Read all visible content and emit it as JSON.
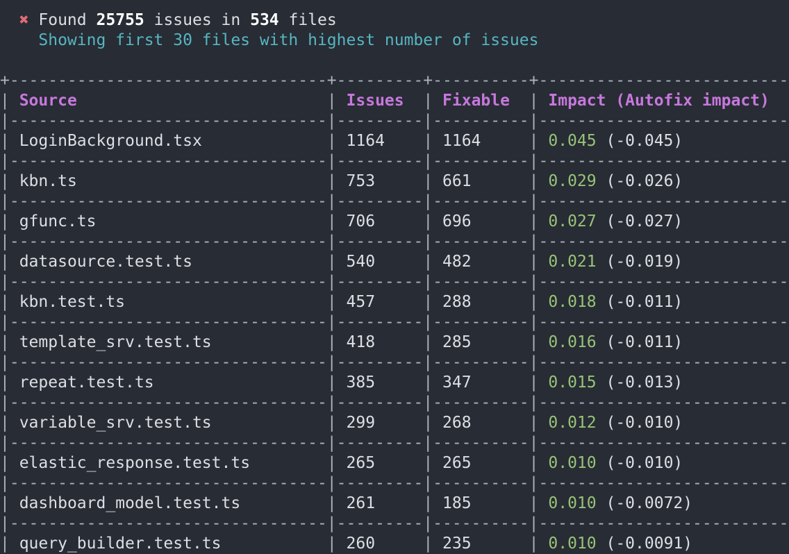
{
  "summary": {
    "icon": "cross-icon",
    "found_word": "Found",
    "issue_count": "25755",
    "issues_in_word": "issues in",
    "file_count": "534",
    "files_word": "files",
    "subtitle": "Showing first 30 files with highest number of issues"
  },
  "table": {
    "columns": {
      "source": "Source",
      "issues": "Issues",
      "fixable": "Fixable",
      "impact": "Impact (Autofix impact)"
    },
    "rows": [
      {
        "source": "LoginBackground.tsx",
        "issues": "1164",
        "fixable": "1164",
        "impact": "0.045",
        "autofix": "(-0.045)"
      },
      {
        "source": "kbn.ts",
        "issues": "753",
        "fixable": "661",
        "impact": "0.029",
        "autofix": "(-0.026)"
      },
      {
        "source": "gfunc.ts",
        "issues": "706",
        "fixable": "696",
        "impact": "0.027",
        "autofix": "(-0.027)"
      },
      {
        "source": "datasource.test.ts",
        "issues": "540",
        "fixable": "482",
        "impact": "0.021",
        "autofix": "(-0.019)"
      },
      {
        "source": "kbn.test.ts",
        "issues": "457",
        "fixable": "288",
        "impact": "0.018",
        "autofix": "(-0.011)"
      },
      {
        "source": "template_srv.test.ts",
        "issues": "418",
        "fixable": "285",
        "impact": "0.016",
        "autofix": "(-0.011)"
      },
      {
        "source": "repeat.test.ts",
        "issues": "385",
        "fixable": "347",
        "impact": "0.015",
        "autofix": "(-0.013)"
      },
      {
        "source": "variable_srv.test.ts",
        "issues": "299",
        "fixable": "268",
        "impact": "0.012",
        "autofix": "(-0.010)"
      },
      {
        "source": "elastic_response.test.ts",
        "issues": "265",
        "fixable": "265",
        "impact": "0.010",
        "autofix": "(-0.010)"
      },
      {
        "source": "dashboard_model.test.ts",
        "issues": "261",
        "fixable": "185",
        "impact": "0.010",
        "autofix": "(-0.0072)"
      },
      {
        "source": "query_builder.test.ts",
        "issues": "260",
        "fixable": "235",
        "impact": "0.010",
        "autofix": "(-0.0091)"
      }
    ]
  }
}
